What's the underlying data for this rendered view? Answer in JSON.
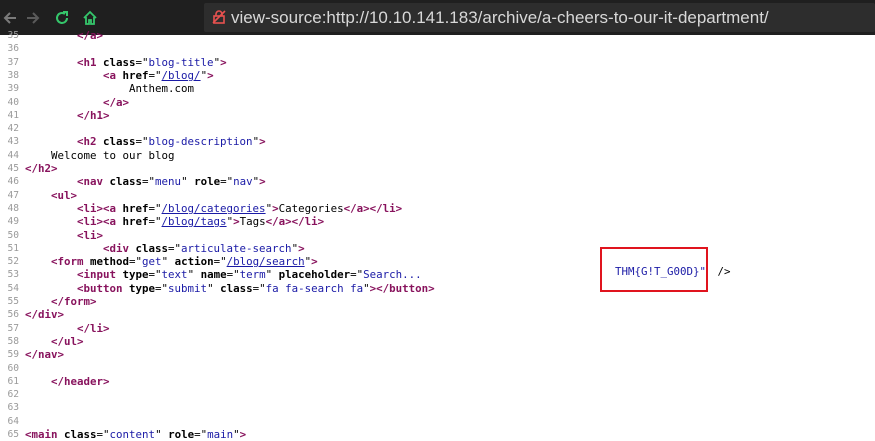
{
  "browser": {
    "url": "view-source:http://10.10.141.183/archive/a-cheers-to-our-it-department/",
    "nav_icons": [
      "back-icon",
      "forward-icon",
      "reload-icon",
      "home-icon",
      "insecure-lock-icon"
    ]
  },
  "colors": {
    "toolbar": "#1f1f1f",
    "urlbar": "#2d2d2d",
    "tag": "#88135d",
    "attr_value": "#1a1aa6",
    "highlight_box": "#e0141e",
    "line_number": "#9a9a9a"
  },
  "lines": [
    {
      "n": "35",
      "parts": [
        {
          "c": "tag",
          "t": "        </a>"
        }
      ]
    },
    {
      "n": "36",
      "parts": []
    },
    {
      "n": "37",
      "parts": [
        {
          "c": "tag",
          "t": "        <h1 "
        },
        {
          "c": "attr",
          "t": "class"
        },
        {
          "c": "plain",
          "t": "=\""
        },
        {
          "c": "val",
          "t": "blog-title"
        },
        {
          "c": "plain",
          "t": "\""
        },
        {
          "c": "tag",
          "t": ">"
        }
      ]
    },
    {
      "n": "38",
      "parts": [
        {
          "c": "tag",
          "t": "            <a "
        },
        {
          "c": "attr",
          "t": "href"
        },
        {
          "c": "plain",
          "t": "=\""
        },
        {
          "c": "link",
          "t": "/blog/"
        },
        {
          "c": "plain",
          "t": "\""
        },
        {
          "c": "tag",
          "t": ">"
        }
      ]
    },
    {
      "n": "39",
      "parts": [
        {
          "c": "plain",
          "t": "                Anthem.com"
        }
      ]
    },
    {
      "n": "40",
      "parts": [
        {
          "c": "tag",
          "t": "            </a>"
        }
      ]
    },
    {
      "n": "41",
      "parts": [
        {
          "c": "tag",
          "t": "        </h1>"
        }
      ]
    },
    {
      "n": "42",
      "parts": []
    },
    {
      "n": "43",
      "parts": [
        {
          "c": "tag",
          "t": "        <h2 "
        },
        {
          "c": "attr",
          "t": "class"
        },
        {
          "c": "plain",
          "t": "=\""
        },
        {
          "c": "val",
          "t": "blog-description"
        },
        {
          "c": "plain",
          "t": "\""
        },
        {
          "c": "tag",
          "t": ">"
        }
      ]
    },
    {
      "n": "44",
      "parts": [
        {
          "c": "plain",
          "t": "    Welcome to our blog"
        }
      ]
    },
    {
      "n": "45",
      "parts": [
        {
          "c": "tag",
          "t": "</h2>"
        }
      ]
    },
    {
      "n": "46",
      "parts": [
        {
          "c": "tag",
          "t": "        <nav "
        },
        {
          "c": "attr",
          "t": "class"
        },
        {
          "c": "plain",
          "t": "=\""
        },
        {
          "c": "val",
          "t": "menu"
        },
        {
          "c": "plain",
          "t": "\" "
        },
        {
          "c": "attr",
          "t": "role"
        },
        {
          "c": "plain",
          "t": "=\""
        },
        {
          "c": "val",
          "t": "nav"
        },
        {
          "c": "plain",
          "t": "\""
        },
        {
          "c": "tag",
          "t": ">"
        }
      ]
    },
    {
      "n": "47",
      "parts": [
        {
          "c": "tag",
          "t": "    <ul>"
        }
      ]
    },
    {
      "n": "48",
      "parts": [
        {
          "c": "tag",
          "t": "        <li><a "
        },
        {
          "c": "attr",
          "t": "href"
        },
        {
          "c": "plain",
          "t": "=\""
        },
        {
          "c": "link",
          "t": "/blog/categories"
        },
        {
          "c": "plain",
          "t": "\""
        },
        {
          "c": "tag",
          "t": ">"
        },
        {
          "c": "plain",
          "t": "Categories"
        },
        {
          "c": "tag",
          "t": "</a></li>"
        }
      ]
    },
    {
      "n": "49",
      "parts": [
        {
          "c": "tag",
          "t": "        <li><a "
        },
        {
          "c": "attr",
          "t": "href"
        },
        {
          "c": "plain",
          "t": "=\""
        },
        {
          "c": "link",
          "t": "/blog/tags"
        },
        {
          "c": "plain",
          "t": "\""
        },
        {
          "c": "tag",
          "t": ">"
        },
        {
          "c": "plain",
          "t": "Tags"
        },
        {
          "c": "tag",
          "t": "</a></li>"
        }
      ]
    },
    {
      "n": "50",
      "parts": [
        {
          "c": "tag",
          "t": "        <li>"
        }
      ]
    },
    {
      "n": "51",
      "parts": [
        {
          "c": "tag",
          "t": "            <div "
        },
        {
          "c": "attr",
          "t": "class"
        },
        {
          "c": "plain",
          "t": "=\""
        },
        {
          "c": "val",
          "t": "articulate-search"
        },
        {
          "c": "plain",
          "t": "\""
        },
        {
          "c": "tag",
          "t": ">"
        }
      ]
    },
    {
      "n": "52",
      "parts": [
        {
          "c": "tag",
          "t": "    <form "
        },
        {
          "c": "attr",
          "t": "method"
        },
        {
          "c": "plain",
          "t": "=\""
        },
        {
          "c": "val",
          "t": "get"
        },
        {
          "c": "plain",
          "t": "\" "
        },
        {
          "c": "attr",
          "t": "action"
        },
        {
          "c": "plain",
          "t": "=\""
        },
        {
          "c": "link",
          "t": "/blog/search"
        },
        {
          "c": "plain",
          "t": "\""
        },
        {
          "c": "tag",
          "t": ">"
        }
      ]
    },
    {
      "n": "53",
      "parts": [
        {
          "c": "tag",
          "t": "        <input "
        },
        {
          "c": "attr",
          "t": "type"
        },
        {
          "c": "plain",
          "t": "=\""
        },
        {
          "c": "val",
          "t": "text"
        },
        {
          "c": "plain",
          "t": "\" "
        },
        {
          "c": "attr",
          "t": "name"
        },
        {
          "c": "plain",
          "t": "=\""
        },
        {
          "c": "val",
          "t": "term"
        },
        {
          "c": "plain",
          "t": "\" "
        },
        {
          "c": "attr",
          "t": "placeholder"
        },
        {
          "c": "plain",
          "t": "=\""
        },
        {
          "c": "val",
          "t": "Search..."
        }
      ]
    },
    {
      "n": "54",
      "parts": [
        {
          "c": "tag",
          "t": "        <button "
        },
        {
          "c": "attr",
          "t": "type"
        },
        {
          "c": "plain",
          "t": "=\""
        },
        {
          "c": "val",
          "t": "submit"
        },
        {
          "c": "plain",
          "t": "\" "
        },
        {
          "c": "attr",
          "t": "class"
        },
        {
          "c": "plain",
          "t": "=\""
        },
        {
          "c": "val",
          "t": "fa fa-search fa"
        },
        {
          "c": "plain",
          "t": "\""
        },
        {
          "c": "tag",
          "t": "></button>"
        }
      ]
    },
    {
      "n": "55",
      "parts": [
        {
          "c": "tag",
          "t": "    </form>"
        }
      ]
    },
    {
      "n": "56",
      "parts": [
        {
          "c": "tag",
          "t": "</div>"
        }
      ]
    },
    {
      "n": "57",
      "parts": [
        {
          "c": "tag",
          "t": "        </li>"
        }
      ]
    },
    {
      "n": "58",
      "parts": [
        {
          "c": "tag",
          "t": "    </ul>"
        }
      ]
    },
    {
      "n": "59",
      "parts": [
        {
          "c": "tag",
          "t": "</nav>"
        }
      ]
    },
    {
      "n": "60",
      "parts": []
    },
    {
      "n": "61",
      "parts": [
        {
          "c": "tag",
          "t": "    </header>"
        }
      ]
    },
    {
      "n": "62",
      "parts": []
    },
    {
      "n": "63",
      "parts": []
    },
    {
      "n": "64",
      "parts": []
    },
    {
      "n": "65",
      "parts": [
        {
          "c": "tag",
          "t": "<main "
        },
        {
          "c": "attr",
          "t": "class"
        },
        {
          "c": "plain",
          "t": "=\""
        },
        {
          "c": "val",
          "t": "content"
        },
        {
          "c": "plain",
          "t": "\" "
        },
        {
          "c": "attr",
          "t": "role"
        },
        {
          "c": "plain",
          "t": "=\""
        },
        {
          "c": "val",
          "t": "main"
        },
        {
          "c": "plain",
          "t": "\""
        },
        {
          "c": "tag",
          "t": ">"
        }
      ]
    }
  ],
  "flag": {
    "value": "THM{G!T_G00D}\"",
    "tail": " />"
  }
}
